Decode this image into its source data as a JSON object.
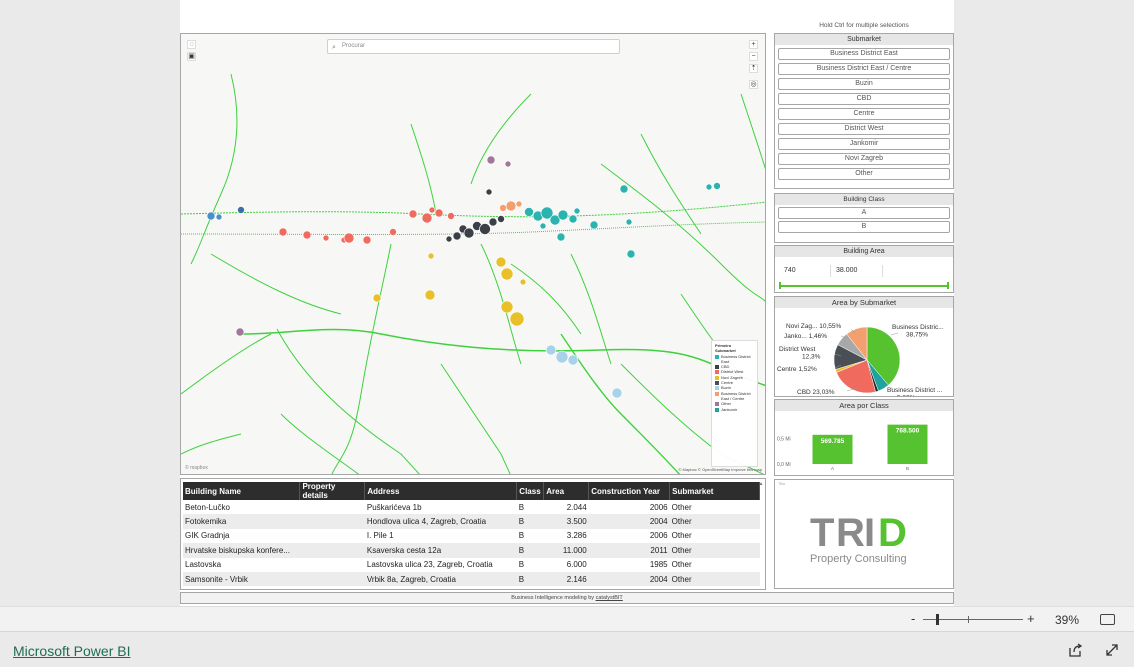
{
  "hint": "Hold Ctrl for multiple selections",
  "map": {
    "search_placeholder": "Procurar",
    "legend_title": "Primeiro",
    "legend_subtitle": "Submarket",
    "legend": [
      {
        "label": "Business District East",
        "color": "#2bb3b0"
      },
      {
        "label": "CBD",
        "color": "#3b3f46"
      },
      {
        "label": "District West",
        "color": "#f06a5e"
      },
      {
        "label": "Novi Zagreb",
        "color": "#e8c02a"
      },
      {
        "label": "Centre",
        "color": "#4a4f56"
      },
      {
        "label": "Buzin",
        "color": "#a8d2ea"
      },
      {
        "label": "Business District East / Centre",
        "color": "#f4a06e"
      },
      {
        "label": "Other",
        "color": "#a0779a"
      },
      {
        "label": "Jankomir",
        "color": "#1fa3a0"
      }
    ],
    "attribution": "© Mapbox © OpenStreetMap  Improve this map",
    "logo": "© mapbox"
  },
  "submarket": {
    "title": "Submarket",
    "items": [
      "Business District East",
      "Business District East / Centre",
      "Buzin",
      "CBD",
      "Centre",
      "District West",
      "Jankomir",
      "Novi Zagreb",
      "Other"
    ]
  },
  "building_class": {
    "title": "Building Class",
    "items": [
      "A",
      "B"
    ]
  },
  "building_area": {
    "title": "Building Area",
    "min": "740",
    "max": "38.000"
  },
  "pie_chart": {
    "title": "Area  by Submarket",
    "labels": {
      "bde": "Business Distric... 38,75%",
      "bdec": "Business District ... 5,62%",
      "cbd": "CBD 23,03%",
      "centre": "Centre 1,52%",
      "dw": "District West 12,3%",
      "jank": "Janko... 1,46%",
      "nz": "Novi Zag... 10,55%"
    }
  },
  "chart_data": [
    {
      "type": "pie",
      "title": "Area  by Submarket",
      "slices": [
        {
          "name": "Business District East",
          "value": 38.75,
          "color": "#56c22f"
        },
        {
          "name": "Business District East / Centre",
          "value": 5.62,
          "color": "#1fa3a0"
        },
        {
          "name": "Jankomir",
          "value": 1.46,
          "color": "#2d2d2d"
        },
        {
          "name": "CBD",
          "value": 23.03,
          "color": "#f06a5e"
        },
        {
          "name": "Centre",
          "value": 1.52,
          "color": "#e8c02a"
        },
        {
          "name": "District West",
          "value": 12.3,
          "color": "#4a4f56"
        },
        {
          "name": "Other",
          "value": 6.77,
          "color": "#a8a8a8"
        },
        {
          "name": "Novi Zagreb",
          "value": 10.55,
          "color": "#f4a06e"
        }
      ]
    },
    {
      "type": "bar",
      "title": "Area  por Class",
      "categories": [
        "A",
        "B"
      ],
      "values": [
        569785,
        768500
      ],
      "value_labels": [
        "569.785",
        "768.500"
      ],
      "yticks": [
        "0,0 Mi",
        "0,5 Mi"
      ],
      "ylim": [
        0,
        800000
      ],
      "color": "#56c22f"
    }
  ],
  "table": {
    "headers": [
      "Building Name",
      "Property details",
      "Address",
      "Class",
      "Area",
      "Construction Year",
      "Submarket"
    ],
    "rows": [
      [
        "Beton-Lučko",
        "",
        "Puškarićeva 1b",
        "B",
        "2.044",
        "2006",
        "Other"
      ],
      [
        "Fotokemika",
        "",
        "Hondlova ulica 4, Zagreb, Croatia",
        "B",
        "3.500",
        "2004",
        "Other"
      ],
      [
        "GIK Gradnja",
        "",
        "I. Pile 1",
        "B",
        "3.286",
        "2006",
        "Other"
      ],
      [
        "Hrvatske biskupska konfere...",
        "",
        "Ksaverska cesta 12a",
        "B",
        "11.000",
        "2011",
        "Other"
      ],
      [
        "Lastovska",
        "",
        "Lastovska ulica 23, Zagreb, Croatia",
        "B",
        "6.000",
        "1985",
        "Other"
      ],
      [
        "Samsonite - Vrbik",
        "",
        "Vrbik 8a, Zagreb, Croatia",
        "B",
        "2.146",
        "2004",
        "Other"
      ]
    ]
  },
  "logo": {
    "letters_t": "T",
    "letters_r": "R",
    "letters_i": "I",
    "letters_d": "D",
    "tagline": "Property Consulting",
    "tiny": "Title"
  },
  "footer": {
    "text": "Business Intelligence modeling by ",
    "link": "catalystBIT"
  },
  "zoom": {
    "value": "39%"
  },
  "brand": "Microsoft Power BI"
}
